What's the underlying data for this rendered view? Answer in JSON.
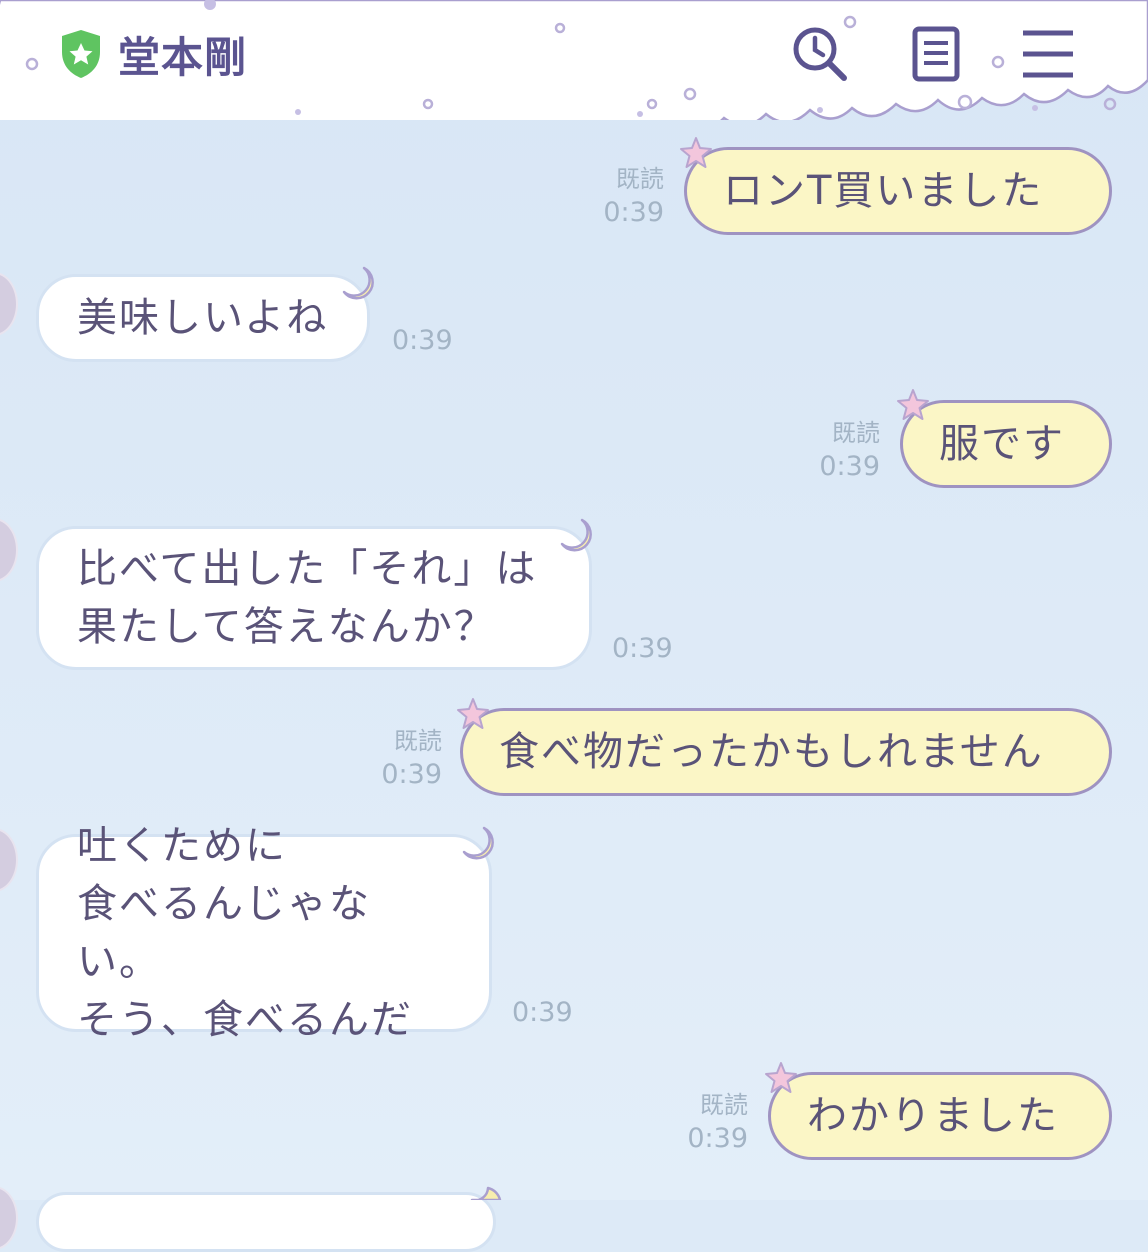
{
  "header": {
    "title": "堂本剛",
    "icons": [
      "shield-star-icon",
      "timeline-search-icon",
      "notes-icon",
      "menu-icon"
    ]
  },
  "messages": [
    {
      "dir": "out",
      "text": "ロンT買いました",
      "read": "既読",
      "time": "0:39"
    },
    {
      "dir": "in",
      "text": "美味しいよね",
      "time": "0:39"
    },
    {
      "dir": "out",
      "text": "服です",
      "read": "既読",
      "time": "0:39"
    },
    {
      "dir": "in",
      "text": "比べて出した「それ」は\n果たして答えなんか？",
      "time": "0:39"
    },
    {
      "dir": "out",
      "text": "食べ物だったかもしれません",
      "read": "既読",
      "time": "0:39"
    },
    {
      "dir": "in",
      "text": "吐くために\n食べるんじゃない。\nそう、食べるんだ",
      "time": "0:39"
    },
    {
      "dir": "out",
      "text": "わかりました",
      "read": "既読",
      "time": "0:39"
    }
  ],
  "colors": {
    "background": "#dde9f7",
    "outgoing_bubble": "#fbf6c6",
    "outgoing_border": "#9f93c1",
    "incoming_bubble": "#ffffff",
    "text": "#5a5378",
    "shield": "#5fc461"
  }
}
